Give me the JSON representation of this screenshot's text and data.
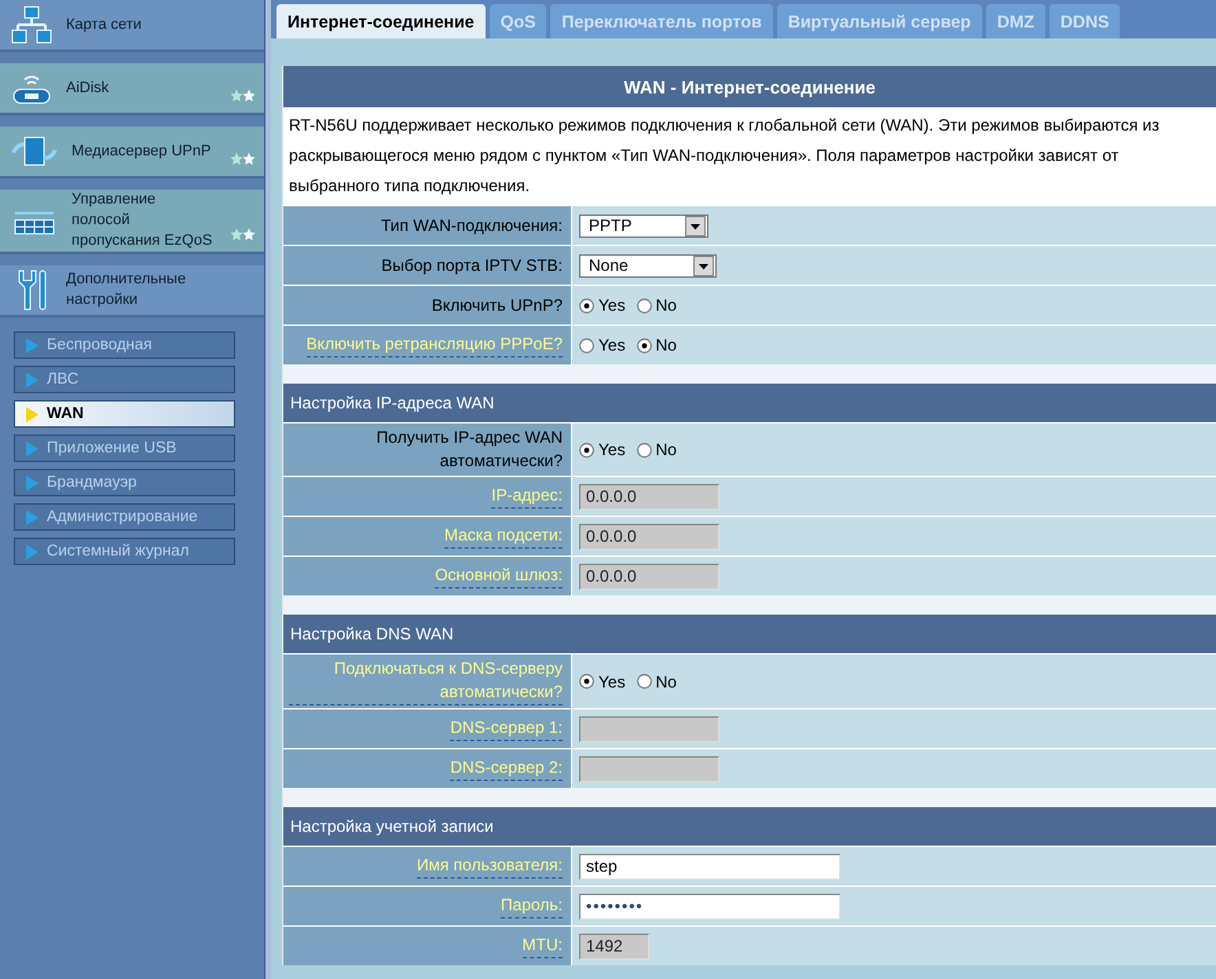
{
  "sidebar": {
    "main_items": [
      {
        "label": "Карта сети",
        "kind": "page"
      },
      {
        "label": "AiDisk",
        "kind": "feature"
      },
      {
        "label": "Медиасервер UPnP",
        "kind": "feature"
      },
      {
        "label": "Управление полосой пропускания EzQoS",
        "kind": "feature"
      },
      {
        "label": "Дополнительные настройки",
        "kind": "page"
      }
    ],
    "sub_items": [
      {
        "label": "Беспроводная",
        "selected": false
      },
      {
        "label": "ЛВС",
        "selected": false
      },
      {
        "label": "WAN",
        "selected": true
      },
      {
        "label": "Приложение USB",
        "selected": false
      },
      {
        "label": "Брандмауэр",
        "selected": false
      },
      {
        "label": "Администрирование",
        "selected": false
      },
      {
        "label": "Системный журнал",
        "selected": false
      }
    ]
  },
  "tabs": [
    {
      "label": "Интернет-соединение",
      "selected": true
    },
    {
      "label": "QoS",
      "selected": false
    },
    {
      "label": "Переключатель портов",
      "selected": false
    },
    {
      "label": "Виртуальный сервер",
      "selected": false
    },
    {
      "label": "DMZ",
      "selected": false
    },
    {
      "label": "DDNS",
      "selected": false
    }
  ],
  "panel": {
    "title": "WAN - Интернет-соединение",
    "description": "RT-N56U поддерживает несколько режимов подключения к глобальной сети (WAN). Эти режимов выбираются из раскрывающегося меню рядом с пунктом «Тип WAN-подключения». Поля параметров настройки зависят от выбранного типа подключения.",
    "sections": [
      {
        "rows": [
          {
            "label": "Тип WAN-подключения:",
            "hint": false,
            "kind": "select",
            "value": "PPTP"
          },
          {
            "label": "Выбор порта IPTV STB:",
            "hint": false,
            "kind": "select",
            "value": "None"
          },
          {
            "label": "Включить UPnP?",
            "hint": false,
            "kind": "radio",
            "options": [
              {
                "label": "Yes",
                "selected": true
              },
              {
                "label": "No",
                "selected": false
              }
            ]
          },
          {
            "label": "Включить ретрансляцию PPPoE?",
            "hint": true,
            "kind": "radio",
            "options": [
              {
                "label": "Yes",
                "selected": false
              },
              {
                "label": "No",
                "selected": true
              }
            ]
          }
        ]
      },
      {
        "title": "Настройка IP-адреса WAN",
        "rows": [
          {
            "label": "Получить IP-адрес WAN автоматически?",
            "hint": false,
            "kind": "radio",
            "options": [
              {
                "label": "Yes",
                "selected": true
              },
              {
                "label": "No",
                "selected": false
              }
            ]
          },
          {
            "label": "IP-адрес:",
            "hint": true,
            "kind": "text",
            "value": "0.0.0.0",
            "disabled": true
          },
          {
            "label": "Маска подсети:",
            "hint": true,
            "kind": "text",
            "value": "0.0.0.0",
            "disabled": true
          },
          {
            "label": "Основной шлюз:",
            "hint": true,
            "kind": "text",
            "value": "0.0.0.0",
            "disabled": true
          }
        ]
      },
      {
        "title": "Настройка DNS WAN",
        "rows": [
          {
            "label": "Подключаться к DNS-серверу автоматически?",
            "hint": true,
            "kind": "radio",
            "options": [
              {
                "label": "Yes",
                "selected": true
              },
              {
                "label": "No",
                "selected": false
              }
            ]
          },
          {
            "label": "DNS-сервер 1:",
            "hint": true,
            "kind": "text",
            "disabled": true
          },
          {
            "label": "DNS-сервер 2:",
            "hint": true,
            "kind": "text",
            "disabled": true
          }
        ]
      },
      {
        "title": "Настройка учетной записи",
        "rows": [
          {
            "label": "Имя пользователя:",
            "hint": true,
            "kind": "wide-text",
            "value": "step",
            "disabled": false
          },
          {
            "label": "Пароль:",
            "hint": true,
            "kind": "password",
            "value": "••••••••",
            "disabled": false
          },
          {
            "label": "MTU:",
            "hint": true,
            "kind": "short-text",
            "value": "1492",
            "disabled": true
          }
        ]
      }
    ]
  }
}
